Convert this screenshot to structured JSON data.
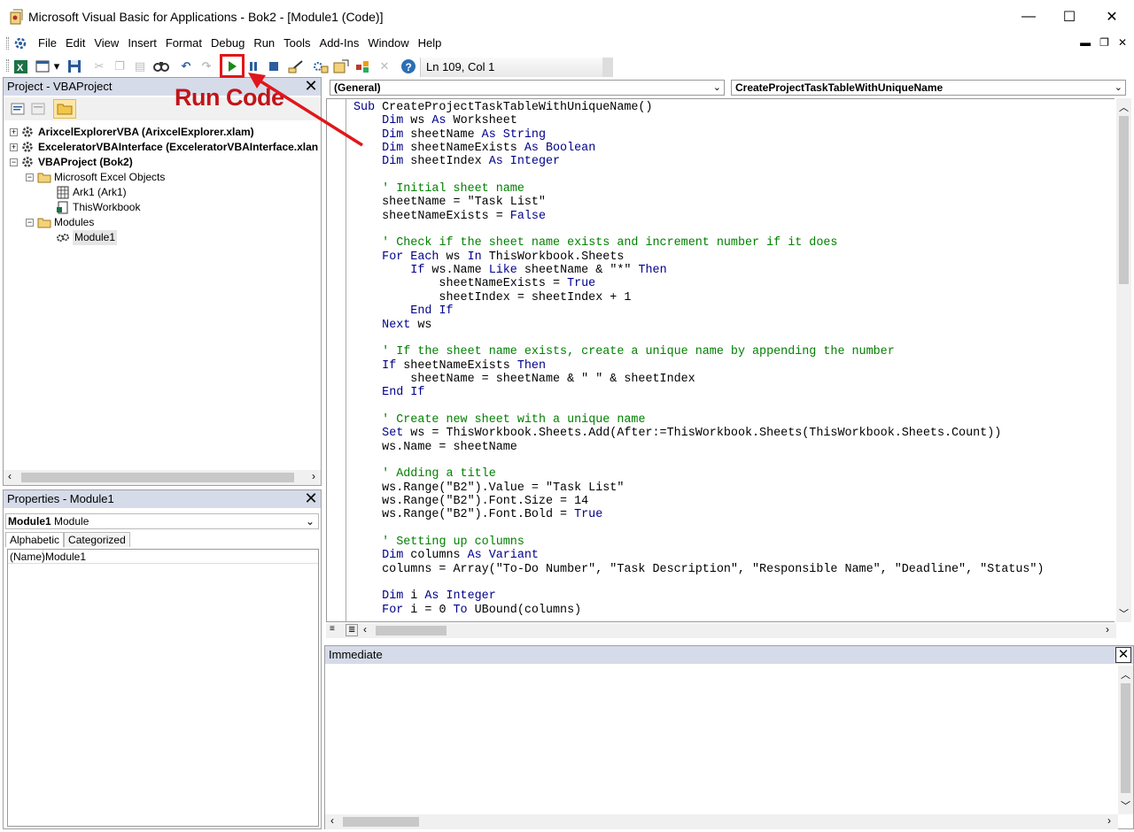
{
  "window": {
    "title": "Microsoft Visual Basic for Applications - Bok2 - [Module1 (Code)]",
    "minimize": "—",
    "maximize": "☐",
    "close": "✕"
  },
  "menu": [
    "File",
    "Edit",
    "View",
    "Insert",
    "Format",
    "Debug",
    "Run",
    "Tools",
    "Add-Ins",
    "Window",
    "Help"
  ],
  "toolbar": {
    "position": "Ln 109, Col 1"
  },
  "project": {
    "title": "Project - VBAProject",
    "tree": [
      {
        "label": "ArixcelExplorerVBA (ArixcelExplorer.xlam)",
        "bold": true
      },
      {
        "label": "ExceleratorVBAInterface (ExceleratorVBAInterface.xlan",
        "bold": true
      },
      {
        "label": "VBAProject (Bok2)",
        "bold": true
      },
      {
        "label": "Microsoft Excel Objects",
        "bold": false
      },
      {
        "label": "Ark1 (Ark1)",
        "bold": false
      },
      {
        "label": "ThisWorkbook",
        "bold": false
      },
      {
        "label": "Modules",
        "bold": false
      },
      {
        "label": "Module1",
        "bold": false
      }
    ]
  },
  "properties": {
    "title": "Properties - Module1",
    "object_name": "Module1",
    "object_type": "Module",
    "tab_alphabetic": "Alphabetic",
    "tab_categorized": "Categorized",
    "row_key": "(Name)",
    "row_value": "Module1"
  },
  "code": {
    "object_dropdown": "(General)",
    "procedure_dropdown": "CreateProjectTaskTableWithUniqueName"
  },
  "immediate": {
    "title": "Immediate"
  },
  "annotation": {
    "label": "Run Code",
    "color": "#e0161b"
  }
}
